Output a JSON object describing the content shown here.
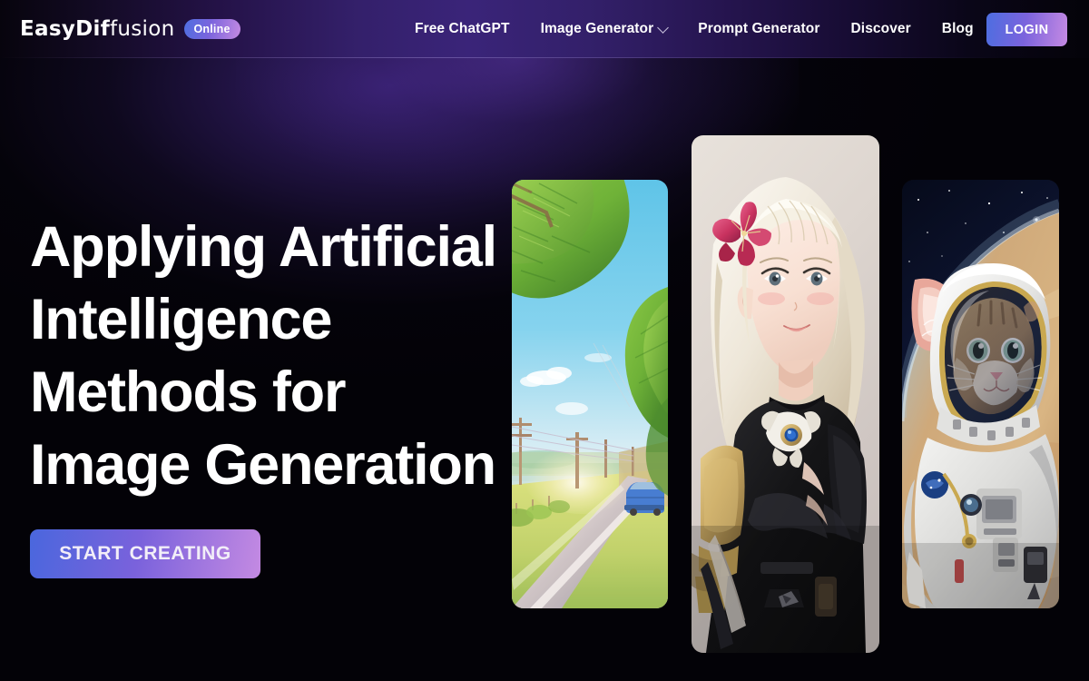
{
  "header": {
    "logo": {
      "text_bold": "EasyDif",
      "text_thin": "fusion",
      "full": "EasyDiffusion"
    },
    "badge": {
      "label": "Online"
    },
    "nav_items": [
      {
        "label": "Free ChatGPT",
        "has_dropdown": false
      },
      {
        "label": "Image Generator",
        "has_dropdown": true
      },
      {
        "label": "Prompt Generator",
        "has_dropdown": false
      },
      {
        "label": "Discover",
        "has_dropdown": false
      },
      {
        "label": "Blog",
        "has_dropdown": false
      }
    ],
    "login_label": "LOGIN"
  },
  "hero": {
    "title_lines": [
      "Applying Artificial",
      "Intelligence",
      "Methods for",
      "Image Generation"
    ],
    "cta_label": "START CREATING"
  },
  "gallery": {
    "cards": [
      {
        "name": "anime-landscape-road",
        "alt": "Anime style sunlit road with green trees, power lines and a blue car"
      },
      {
        "name": "anime-woman-armor",
        "alt": "Anime style woman with white hair, pink flower ornament and black gold armor"
      },
      {
        "name": "astronaut-cat",
        "alt": "Cat wearing a white astronaut spacesuit floating in space above Earth"
      }
    ]
  },
  "colors": {
    "accent_blue": "#4d6ee0",
    "accent_purple": "#7b63dd",
    "accent_pink": "#c58ae3",
    "header_purple": "#3a2479",
    "page_background": "#030207",
    "text_primary": "#ffffff"
  }
}
